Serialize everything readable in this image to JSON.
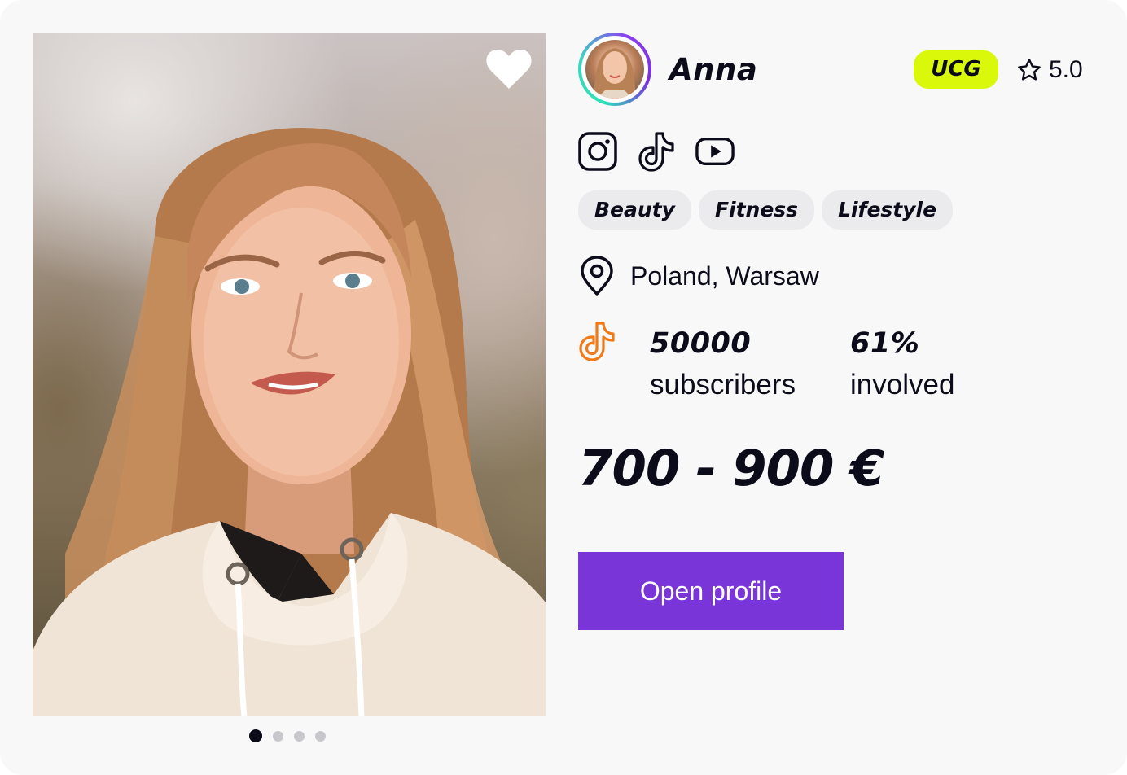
{
  "creator": {
    "name": "Anna",
    "badge": "UCG",
    "rating": "5.0",
    "tags": [
      "Beauty",
      "Fitness",
      "Lifestyle"
    ],
    "location": "Poland, Warsaw"
  },
  "socials": [
    "instagram-icon",
    "tiktok-icon",
    "youtube-icon"
  ],
  "stats": {
    "platform_icon": "tiktok-icon",
    "subscribers_value": "50000",
    "subscribers_label": "subscribers",
    "involved_value": "61%",
    "involved_label": "involved"
  },
  "price": "700 - 900 €",
  "actions": {
    "open_profile": "Open profile"
  },
  "carousel": {
    "total": 4,
    "active_index": 0
  },
  "colors": {
    "accent": "#7a35d8",
    "badge": "#d9f80a",
    "tiktok_accent": "#f07a18",
    "avatar_ring_start": "#2ce3b6",
    "avatar_ring_end": "#8a3ff0"
  }
}
